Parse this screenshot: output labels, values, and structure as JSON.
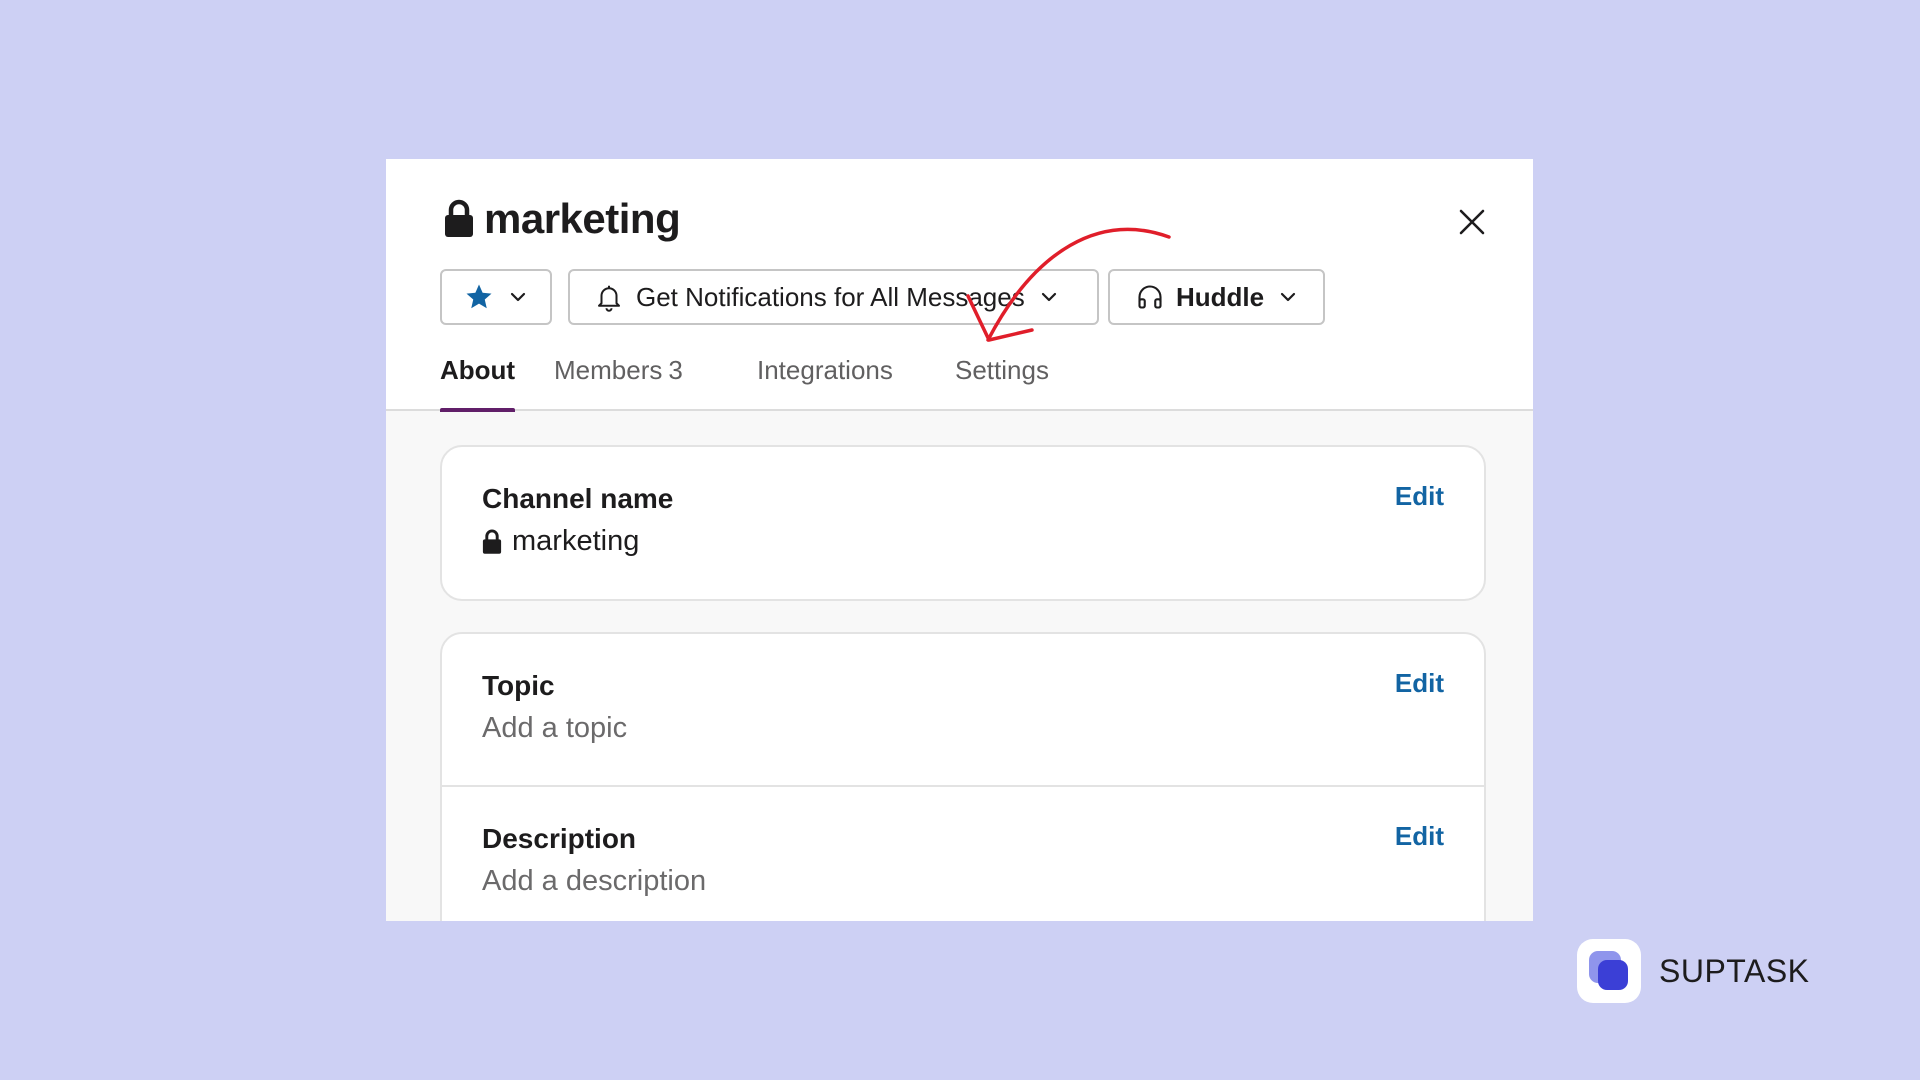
{
  "header": {
    "title": "marketing",
    "icons": {
      "title": "lock-icon",
      "close": "close-icon"
    }
  },
  "actions": {
    "star": {
      "icon": "star-icon",
      "color": "#1264a3"
    },
    "notifications": {
      "label": "Get Notifications for All Messages",
      "icon": "bell-icon"
    },
    "huddle": {
      "label": "Huddle",
      "icon": "headphones-icon"
    }
  },
  "tabs": [
    {
      "label": "About",
      "active": true
    },
    {
      "label": "Members",
      "count": "3"
    },
    {
      "label": "Integrations"
    },
    {
      "label": "Settings"
    }
  ],
  "fields": {
    "channel_name": {
      "label": "Channel name",
      "value": "marketing",
      "edit": "Edit"
    },
    "topic": {
      "label": "Topic",
      "placeholder": "Add a topic",
      "edit": "Edit"
    },
    "description": {
      "label": "Description",
      "placeholder": "Add a description",
      "edit": "Edit"
    }
  },
  "annotation": {
    "type": "hand-drawn arrow",
    "color": "#e01e2a",
    "points_to": "Settings"
  },
  "brand": {
    "name": "SUPTASK",
    "icon": "suptask-logo"
  },
  "colors": {
    "background": "#cdd0f4",
    "active_tab": "#611f69",
    "link": "#1264a3"
  }
}
